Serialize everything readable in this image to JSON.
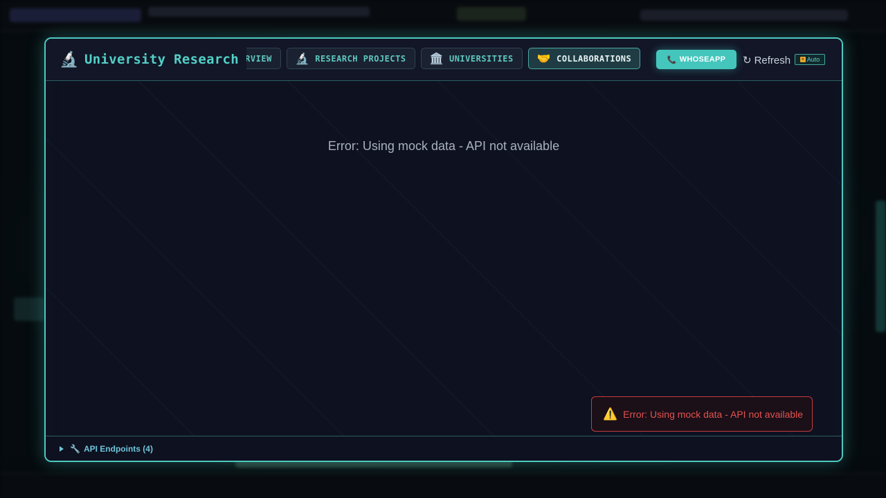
{
  "header": {
    "title_icon": "microscope-icon",
    "title": "University Research",
    "tabs": [
      {
        "icon": "",
        "label": "OVERVIEW",
        "active": false
      },
      {
        "icon": "🔬",
        "label": "RESEARCH PROJECTS",
        "active": false
      },
      {
        "icon": "🏛️",
        "label": "UNIVERSITIES",
        "active": false
      },
      {
        "icon": "🤝",
        "label": "COLLABORATIONS",
        "active": true
      }
    ],
    "whoseapp_icon": "📞",
    "whoseapp_label": "WHOSEAPP",
    "refresh_icon": "↻",
    "refresh_label": "Refresh",
    "auto_label": "Auto"
  },
  "content": {
    "error_message": "Error: Using mock data - API not available"
  },
  "toast": {
    "icon": "⚠️",
    "message": "Error: Using mock data - API not available"
  },
  "footer": {
    "api_icon": "🔧",
    "api_label": "API Endpoints (4)"
  },
  "colors": {
    "accent": "#4ec9c0",
    "background": "#0e1120",
    "error": "#e2534f"
  }
}
